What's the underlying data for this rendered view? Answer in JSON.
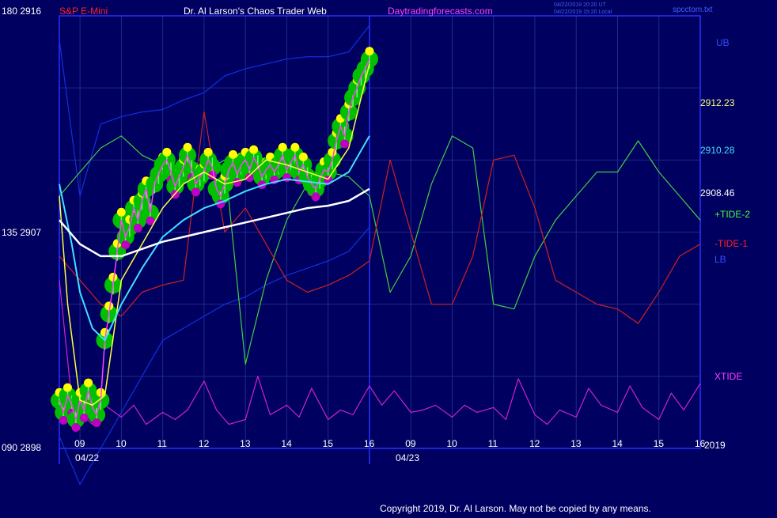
{
  "header": {
    "left_scale": "180  2916",
    "symbol": "S&P E-Mini",
    "title": "Dr. Al Larson's Chaos Trader Web",
    "site": "Daytradingforecasts.com",
    "timestamp_utc": "04/22/2019 20:20 UT",
    "timestamp_local": "04/22/2019 15:20 Local",
    "filename": "spcctom.txt"
  },
  "y_axis_left": [
    {
      "label": "180  2916",
      "value": 2916
    },
    {
      "label": "135  2907",
      "value": 2907
    },
    {
      "label": "090  2898",
      "value": 2898
    }
  ],
  "right_labels": {
    "ub": "UB",
    "lb": "LB",
    "price_1": "2912.23",
    "price_2": "2910.28",
    "price_3": "2908.46",
    "tide2": "+TIDE-2",
    "tide1": "-TIDE-1",
    "xtide": "XTIDE",
    "year": "2019"
  },
  "x_axis": {
    "hours": [
      "09",
      "10",
      "11",
      "12",
      "13",
      "14",
      "15",
      "16",
      "09",
      "10",
      "11",
      "12",
      "13",
      "14",
      "15",
      "16"
    ],
    "dates": [
      "04/22",
      "04/23"
    ]
  },
  "footer": {
    "copyright": "Copyright 2019, Dr. Al Larson. May not be copied by any means."
  },
  "colors": {
    "background": "#000060",
    "grid": "#1e2a8a",
    "frame": "#2a30ff",
    "price_green": "#00c000",
    "price_yellow": "#ffff00",
    "price_magenta": "#c000c0",
    "ma_yellow": "#ffff40",
    "ma_cyan": "#40e0ff",
    "ma_white": "#ffffff",
    "tide_green": "#40d040",
    "tide_red": "#d02020",
    "band_blue": "#1030e0",
    "xtide": "#d020d0",
    "label_red": "#ff2020",
    "label_magenta": "#ff40ff",
    "label_yellow": "#ffff80",
    "label_cyan": "#40e0ff",
    "label_blue": "#2040ff",
    "label_green": "#40ff40"
  },
  "chart_data": {
    "type": "line",
    "title": "S&P E-Mini",
    "ylim": [
      2898,
      2916
    ],
    "x_sessions": [
      "04/22",
      "04/23"
    ],
    "series": [
      {
        "name": "UB",
        "role": "upper band",
        "x": [
          8.5,
          9.0,
          9.5,
          10.0,
          10.5,
          11.0,
          11.5,
          12.0,
          12.5,
          13.0,
          13.5,
          14.0,
          14.5,
          15.0,
          15.5,
          16.0
        ],
        "values": [
          2915.0,
          2908.5,
          2911.5,
          2911.8,
          2912.0,
          2912.1,
          2912.5,
          2912.8,
          2913.5,
          2913.8,
          2914.0,
          2914.2,
          2914.3,
          2914.3,
          2914.5,
          2915.6
        ]
      },
      {
        "name": "LB",
        "role": "lower band",
        "x": [
          8.5,
          9.0,
          9.5,
          10.0,
          10.5,
          11.0,
          11.5,
          12.0,
          12.5,
          13.0,
          13.5,
          14.0,
          14.5,
          15.0,
          15.5,
          16.0
        ],
        "values": [
          2898.5,
          2896.5,
          2898.0,
          2899.5,
          2901.0,
          2902.5,
          2903.0,
          2903.5,
          2904.0,
          2904.3,
          2904.8,
          2905.2,
          2905.5,
          2905.8,
          2906.2,
          2907.2
        ]
      },
      {
        "name": "+TIDE-2",
        "role": "green tide",
        "x": [
          8.5,
          9.0,
          9.5,
          10.0,
          10.5,
          11.0,
          11.5,
          12.0,
          12.5,
          13.0,
          13.5,
          14.0,
          14.5,
          15.0,
          15.5,
          16.0,
          16.5,
          17.0,
          17.5,
          18.0,
          18.5,
          19.0,
          19.5,
          20.0,
          20.5,
          21.0,
          21.5,
          22.0,
          22.5,
          23.0,
          23.5,
          24.0
        ],
        "values": [
          2908.5,
          2909.5,
          2910.5,
          2911.0,
          2910.2,
          2909.8,
          2909.5,
          2909.5,
          2910.0,
          2901.5,
          2905.0,
          2907.5,
          2909.0,
          2909.5,
          2909.3,
          2908.5,
          2904.5,
          2906.0,
          2909.0,
          2911.0,
          2910.5,
          2904.0,
          2903.8,
          2906.0,
          2907.5,
          2908.5,
          2909.5,
          2909.5,
          2910.8,
          2909.5,
          2908.5,
          2907.5
        ]
      },
      {
        "name": "-TIDE-1",
        "role": "red tide",
        "x": [
          8.5,
          9.0,
          9.5,
          10.0,
          10.5,
          11.0,
          11.5,
          12.0,
          12.5,
          13.0,
          13.5,
          14.0,
          14.5,
          15.0,
          15.5,
          16.0,
          16.5,
          17.0,
          17.5,
          18.0,
          18.5,
          19.0,
          19.5,
          20.0,
          20.5,
          21.0,
          21.5,
          22.0,
          22.5,
          23.0,
          23.5,
          24.0
        ],
        "values": [
          2906.0,
          2905.0,
          2904.0,
          2903.5,
          2904.5,
          2904.8,
          2905.0,
          2912.0,
          2907.0,
          2908.0,
          2906.5,
          2905.0,
          2904.5,
          2904.8,
          2905.2,
          2905.8,
          2910.0,
          2907.0,
          2904.0,
          2904.0,
          2906.0,
          2910.0,
          2910.2,
          2908.0,
          2905.0,
          2904.5,
          2904.0,
          2903.8,
          2903.2,
          2904.5,
          2906.0,
          2906.5
        ]
      },
      {
        "name": "MA fast",
        "role": "yellow average",
        "x": [
          8.5,
          8.7,
          9.0,
          9.3,
          9.6,
          10.0,
          10.5,
          11.0,
          11.5,
          12.0,
          12.5,
          13.0,
          13.5,
          14.0,
          14.5,
          15.0,
          15.5,
          16.0
        ],
        "values": [
          2908.5,
          2904.0,
          2900.0,
          2899.8,
          2900.2,
          2905.0,
          2906.5,
          2908.0,
          2909.0,
          2909.5,
          2909.0,
          2909.2,
          2910.0,
          2909.8,
          2909.5,
          2909.2,
          2910.5,
          2914.0
        ]
      },
      {
        "name": "MA medium",
        "role": "cyan average",
        "x": [
          8.5,
          8.8,
          9.0,
          9.3,
          9.6,
          10.0,
          10.5,
          11.0,
          11.5,
          12.0,
          12.5,
          13.0,
          13.5,
          14.0,
          14.5,
          15.0,
          15.5,
          16.0
        ],
        "values": [
          2909.0,
          2906.5,
          2904.5,
          2903.0,
          2902.5,
          2904.0,
          2905.5,
          2906.8,
          2907.5,
          2908.0,
          2908.3,
          2908.7,
          2909.0,
          2909.2,
          2909.1,
          2909.0,
          2909.5,
          2911.0
        ]
      },
      {
        "name": "MA slow",
        "role": "white average",
        "x": [
          8.5,
          9.0,
          9.5,
          10.0,
          10.5,
          11.0,
          11.5,
          12.0,
          12.5,
          13.0,
          13.5,
          14.0,
          14.5,
          15.0,
          15.5,
          16.0
        ],
        "values": [
          2907.5,
          2906.5,
          2906.0,
          2906.0,
          2906.3,
          2906.6,
          2906.8,
          2907.0,
          2907.2,
          2907.4,
          2907.6,
          2907.8,
          2908.0,
          2908.1,
          2908.3,
          2908.8
        ]
      },
      {
        "name": "XTIDE",
        "role": "magenta oscillator",
        "x": [
          8.5,
          8.8,
          9.0,
          9.3,
          9.6,
          10.0,
          10.3,
          10.6,
          11.0,
          11.3,
          11.6,
          12.0,
          12.3,
          12.6,
          13.0,
          13.3,
          13.6,
          14.0,
          14.3,
          14.6,
          15.0,
          15.3,
          15.6,
          16.0,
          16.3,
          16.6,
          17.0,
          17.3,
          17.6,
          18.0,
          18.3,
          18.6,
          19.0,
          19.3,
          19.6,
          20.0,
          20.3,
          20.6,
          21.0,
          21.3,
          21.6,
          22.0,
          22.3,
          22.6,
          23.0,
          23.3,
          23.6,
          24.0
        ],
        "values": [
          2905.0,
          2900.0,
          2899.5,
          2899.0,
          2899.8,
          2899.3,
          2899.8,
          2899.0,
          2899.5,
          2899.2,
          2899.6,
          2900.8,
          2899.6,
          2899.0,
          2899.2,
          2901.0,
          2899.4,
          2899.8,
          2899.3,
          2900.5,
          2899.2,
          2899.6,
          2899.4,
          2900.6,
          2899.8,
          2900.4,
          2899.5,
          2899.6,
          2899.8,
          2899.3,
          2899.8,
          2899.5,
          2899.7,
          2899.2,
          2900.9,
          2899.4,
          2899.0,
          2899.6,
          2899.3,
          2900.5,
          2899.8,
          2899.5,
          2900.6,
          2899.7,
          2899.2,
          2900.3,
          2899.6,
          2900.7
        ]
      }
    ],
    "price_bars": {
      "name": "S&P E-Mini",
      "x": [
        8.5,
        8.6,
        8.7,
        8.8,
        8.9,
        9.0,
        9.1,
        9.2,
        9.3,
        9.4,
        9.5,
        9.6,
        9.7,
        9.8,
        9.9,
        10.0,
        10.1,
        10.2,
        10.3,
        10.4,
        10.5,
        10.6,
        10.7,
        10.8,
        10.9,
        11.0,
        11.1,
        11.2,
        11.3,
        11.4,
        11.5,
        11.6,
        11.7,
        11.8,
        11.9,
        12.0,
        12.1,
        12.2,
        12.3,
        12.4,
        12.5,
        12.6,
        12.7,
        12.8,
        12.9,
        13.0,
        13.1,
        13.2,
        13.3,
        13.4,
        13.5,
        13.6,
        13.7,
        13.8,
        13.9,
        14.0,
        14.1,
        14.2,
        14.3,
        14.4,
        14.5,
        14.6,
        14.7,
        14.8,
        14.9,
        15.0,
        15.1,
        15.2,
        15.3,
        15.4,
        15.5,
        15.6,
        15.7,
        15.8,
        15.9,
        16.0
      ],
      "close": [
        2900.0,
        2899.5,
        2900.2,
        2899.8,
        2899.2,
        2900.0,
        2899.6,
        2900.4,
        2899.7,
        2899.4,
        2900.0,
        2902.5,
        2903.6,
        2904.8,
        2906.2,
        2907.5,
        2906.8,
        2907.2,
        2908.0,
        2907.5,
        2908.3,
        2908.8,
        2907.8,
        2909.0,
        2909.4,
        2909.8,
        2910.0,
        2909.5,
        2908.9,
        2909.3,
        2909.7,
        2910.2,
        2909.6,
        2909.0,
        2909.3,
        2909.5,
        2910.0,
        2909.7,
        2908.8,
        2908.5,
        2909.0,
        2909.6,
        2909.9,
        2909.4,
        2909.8,
        2910.0,
        2909.6,
        2910.1,
        2909.8,
        2909.3,
        2909.6,
        2909.8,
        2909.5,
        2909.8,
        2910.2,
        2909.6,
        2909.9,
        2910.2,
        2909.5,
        2909.8,
        2909.3,
        2909.0,
        2908.8,
        2909.2,
        2909.6,
        2909.5,
        2910.0,
        2910.8,
        2911.4,
        2911.0,
        2912.0,
        2912.6,
        2913.0,
        2913.5,
        2913.8,
        2914.2
      ]
    }
  }
}
